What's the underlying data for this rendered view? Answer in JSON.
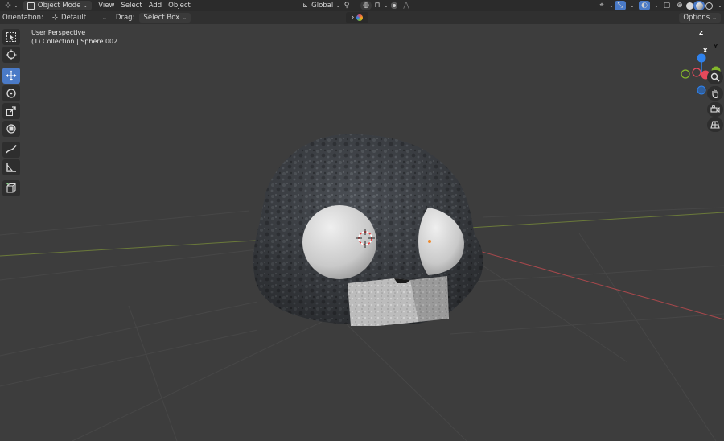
{
  "header": {
    "mode": "Object Mode",
    "menu": [
      "View",
      "Select",
      "Add",
      "Object"
    ],
    "transform_orientation": "Global"
  },
  "tool_settings": {
    "orientation_label": "Orientation:",
    "orientation_value": "Default",
    "drag_label": "Drag:",
    "drag_value": "Select Box",
    "options_label": "Options"
  },
  "viewport": {
    "view_name": "User Perspective",
    "collection_info": "(1) Collection | Sphere.002"
  },
  "gizmo": {
    "z": "Z",
    "y": "Y",
    "x": "X"
  },
  "toolbar": [
    "select-box",
    "cursor",
    "move",
    "rotate",
    "scale",
    "transform",
    "annotate",
    "measure",
    "add-cube"
  ],
  "active_tool": "move",
  "colors": {
    "active": "#4a7ac7",
    "x_axis": "#e5495b",
    "y_axis": "#84b82b",
    "z_axis": "#2f82ed"
  }
}
